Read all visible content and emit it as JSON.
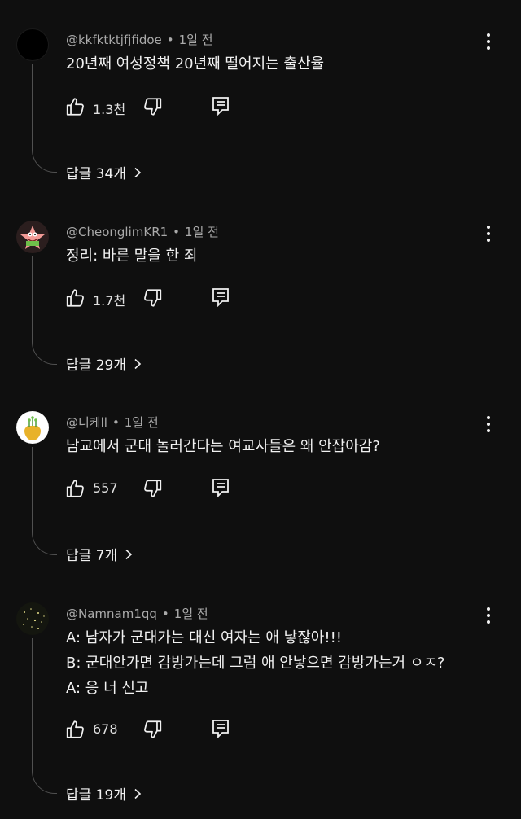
{
  "comments": [
    {
      "handle": "@kkfktktjfjfidoe",
      "sep": "•",
      "time": "1일 전",
      "lines": [
        "20년째 여성정책 20년째 떨어지는 출산율"
      ],
      "likes": "1.3천",
      "replies": "답글 34개",
      "avatar_color": "#000000"
    },
    {
      "handle": "@CheonglimKR1",
      "sep": "•",
      "time": "1일 전",
      "lines": [
        "정리: 바른 말을 한 죄"
      ],
      "likes": "1.7천",
      "replies": "답글 29개",
      "avatar_color": "#3a2a2a"
    },
    {
      "handle": "@디케ll",
      "sep": "•",
      "time": "1일 전",
      "lines": [
        "남교에서 군대 놀러간다는 여교사들은 왜 안잡아감?"
      ],
      "likes": "557",
      "replies": "답글 7개",
      "avatar_color": "#ffffff"
    },
    {
      "handle": "@Namnam1qq",
      "sep": "•",
      "time": "1일 전",
      "lines": [
        "A: 남자가 군대가는 대신 여자는 애 낳잖아!!!",
        "B: 군대안가면 감방가는데 그럼 애 안낳으면 감방가는거 ㅇㅈ?",
        "A: 응 너 신고"
      ],
      "likes": "678",
      "replies": "답글 19개",
      "avatar_color": "#14160f"
    }
  ],
  "icons": {
    "like": "thumbs-up-icon",
    "dislike": "thumbs-down-icon",
    "reply": "reply-comment-icon",
    "menu": "more-vert-icon",
    "chevron": "chevron-right-icon"
  }
}
